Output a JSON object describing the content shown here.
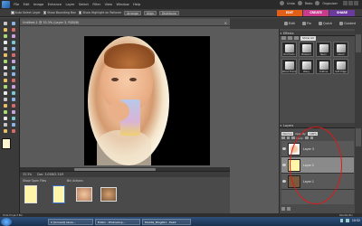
{
  "menubar": {
    "items": [
      "File",
      "Edit",
      "Image",
      "Enhance",
      "Layer",
      "Select",
      "Filter",
      "View",
      "Window",
      "Help"
    ],
    "right_items": [
      "Undo",
      "Redo",
      "Organizer"
    ]
  },
  "options_bar": {
    "auto_select_label": "Auto Select Layer",
    "bounding_box_label": "Show Bounding Box",
    "highlight_label": "Show Highlight on Rollover",
    "arrange_label": "Arrange",
    "align_label": "Align",
    "distribute_label": "Distribute"
  },
  "mode_tabs": [
    {
      "label": "EDIT",
      "color": "#e0601a"
    },
    {
      "label": "CREATE",
      "color": "#c83a8c"
    },
    {
      "label": "SHARE",
      "color": "#6a3a9c"
    }
  ],
  "document": {
    "tab_title": "Untitled-1 @ 33.3% (Layer 3, RGB/8)",
    "close": "×"
  },
  "bin_bar": {
    "zoom": "33.3%",
    "doc_info": "Doc: 3.05M/5.31M",
    "project_bin_label": "Project Bin",
    "show_open_files": "Show Open Files",
    "bin_actions": "Bin Actions"
  },
  "right_panel": {
    "tabs": [
      "Edit",
      "Fix",
      "Quick",
      "Guided"
    ],
    "effects_title": "Effects",
    "effects_dropdown": "Show All",
    "effects": [
      "Old Photo",
      "Blizzard",
      "Neon",
      "Lizard",
      "Wood Frame",
      "Wavy",
      "Outline",
      "Soft Edge"
    ],
    "layers_title": "Layers",
    "blend_mode": "Normal",
    "opacity_label": "Opacity:",
    "opacity_value": "100%",
    "lock_label": "Lock:",
    "layers": [
      {
        "name": "Layer 3",
        "selected": false
      },
      {
        "name": "Layer 2",
        "selected": true
      },
      {
        "name": "Layer 1",
        "selected": false
      }
    ]
  },
  "status": {
    "left": "Hide Project Bin",
    "right": "Palette Bin"
  },
  "taskbar": {
    "items": [
      "0 [Unread] skule...",
      "Editor - Photoshop...",
      "Mozilla_Blog001 - Paint"
    ],
    "clock": "10:52"
  },
  "colors": {
    "annotation_circle": "#e01818",
    "foreground_swatch": "#fff6d0"
  }
}
